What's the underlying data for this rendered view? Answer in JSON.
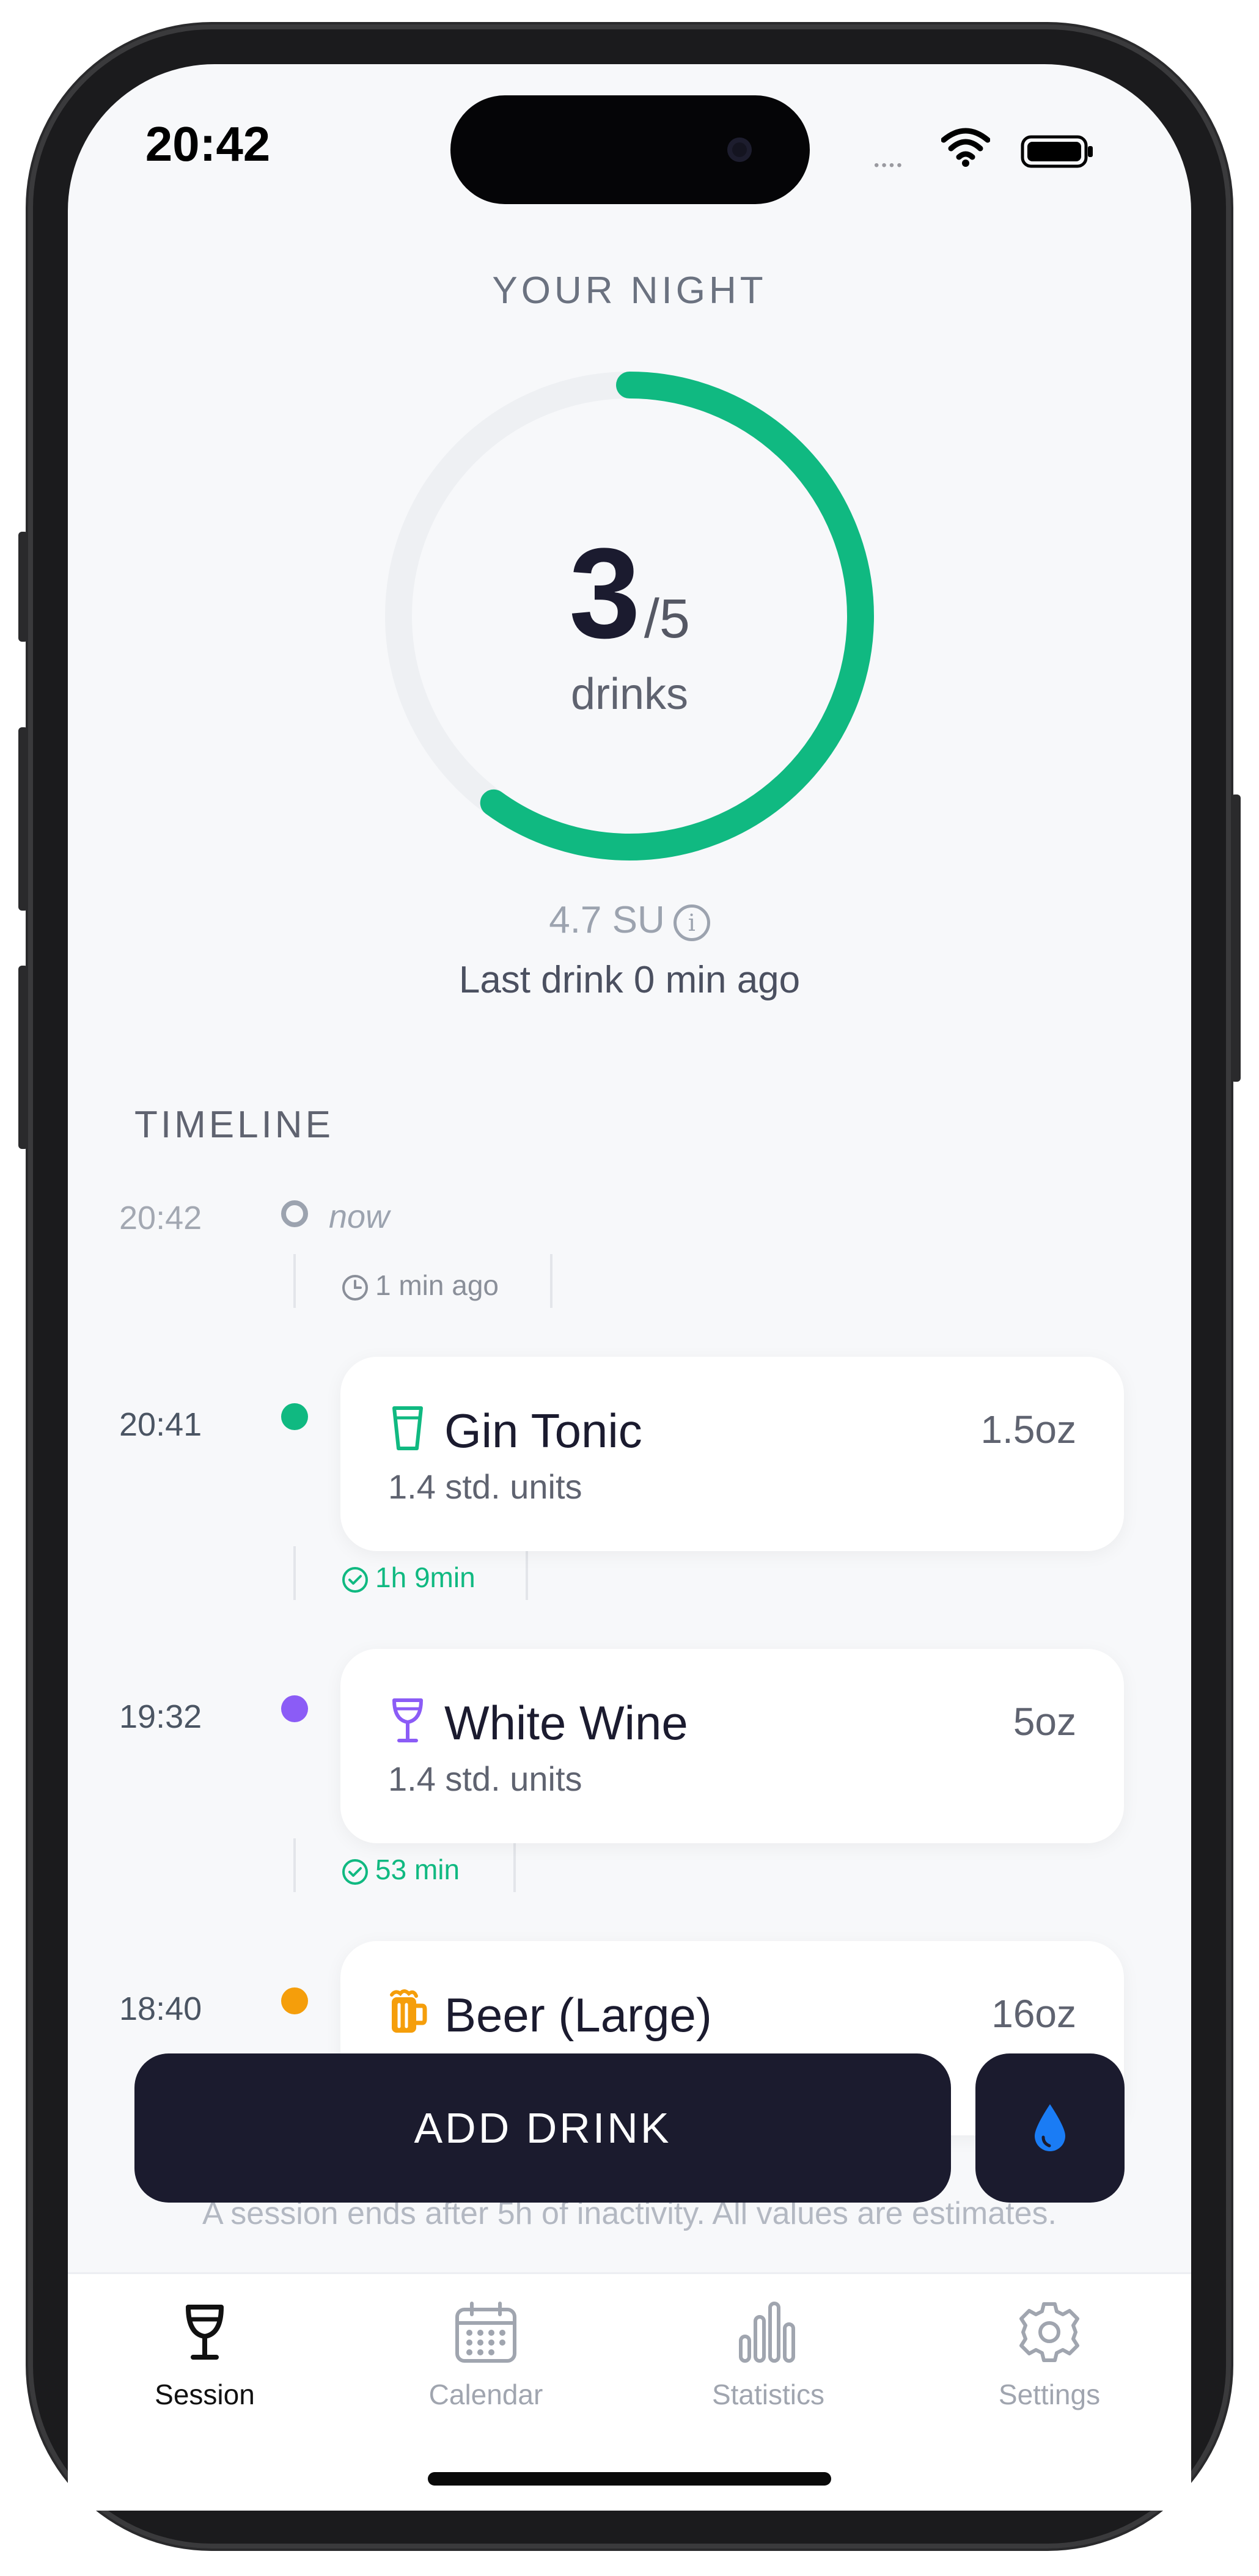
{
  "status_bar": {
    "time": "20:42",
    "signal": "••••"
  },
  "header": {
    "title": "YOUR NIGHT"
  },
  "progress": {
    "count": "3",
    "max_label": "/5",
    "unit": "drinks",
    "fraction": 0.6
  },
  "stats": {
    "su": "4.7 SU",
    "last_drink": "Last drink 0 min ago"
  },
  "timeline": {
    "title": "TIMELINE",
    "now_time": "20:42",
    "now_label": "now",
    "gaps": [
      {
        "label": "1 min ago",
        "icon": "clock-icon",
        "color": "#8a8f99"
      },
      {
        "label": "1h 9min",
        "icon": "check-circle-icon",
        "color": "#10b981"
      },
      {
        "label": "53 min",
        "icon": "check-circle-icon",
        "color": "#10b981"
      }
    ],
    "entries": [
      {
        "time": "20:41",
        "name": "Gin Tonic",
        "amount": "1.5oz",
        "units": "1.4 std. units",
        "icon": "glass-icon",
        "color": "#10b981"
      },
      {
        "time": "19:32",
        "name": "White Wine",
        "amount": "5oz",
        "units": "1.4 std. units",
        "icon": "wine-glass-icon",
        "color": "#8b5cf6"
      },
      {
        "time": "18:40",
        "name": "Beer (Large)",
        "amount": "16oz",
        "units": "",
        "icon": "beer-mug-icon",
        "color": "#f59e0b"
      }
    ]
  },
  "actions": {
    "add_drink": "ADD DRINK",
    "water_icon": "water-drop-icon"
  },
  "disclaimer": "A session ends after 5h of inactivity. All values are estimates.",
  "tabs": [
    {
      "label": "Session",
      "icon": "wine-glass-icon",
      "active": true
    },
    {
      "label": "Calendar",
      "icon": "calendar-icon",
      "active": false
    },
    {
      "label": "Statistics",
      "icon": "bar-chart-icon",
      "active": false
    },
    {
      "label": "Settings",
      "icon": "gear-icon",
      "active": false
    }
  ],
  "colors": {
    "accent": "#10b981",
    "dark": "#1b1b2e",
    "water": "#1a7cf5"
  }
}
